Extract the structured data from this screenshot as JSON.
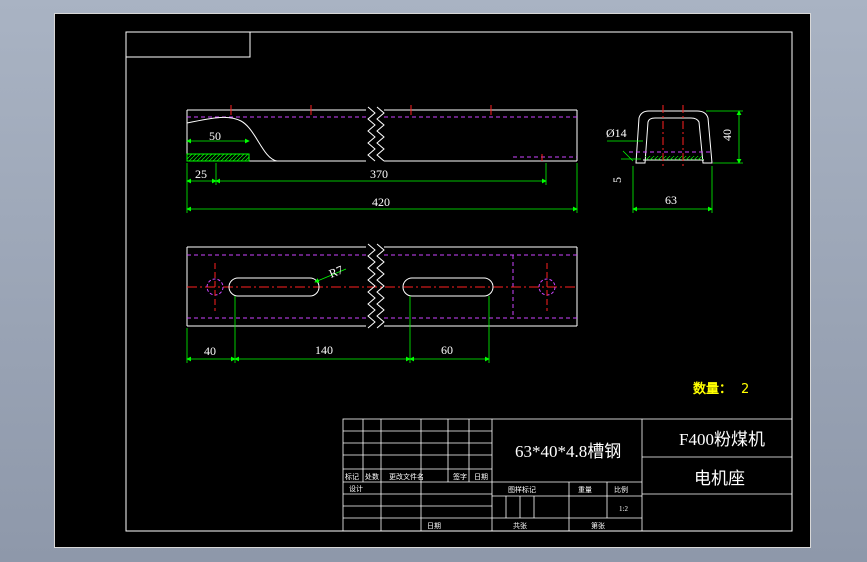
{
  "drawing": {
    "dims_top": {
      "d50": "50",
      "d25": "25",
      "d370": "370",
      "d420": "420"
    },
    "dims_side": {
      "phi14": "Ø14",
      "d40": "40",
      "d5": "5",
      "d63": "63"
    },
    "dims_bottom": {
      "r7": "R7",
      "d40": "40",
      "d140": "140",
      "d60": "60"
    },
    "quantity_label": "数量：",
    "quantity_value": "2"
  },
  "title_block": {
    "material": "63*40*4.8槽钢",
    "project": "F400粉煤机",
    "part_name": "电机座",
    "header_labels": [
      "标记",
      "处数",
      "更改文件名",
      "签字",
      "日期"
    ],
    "design_label": "设计",
    "date_label": "日期",
    "stage_labels": [
      "图样标记",
      "重量",
      "比例"
    ],
    "scale": "1:2",
    "sheet_labels": [
      "共张",
      "第张"
    ]
  },
  "colors": {
    "sheet_bg": "#000000",
    "outline": "#ffffff",
    "dimension": "#00ff00",
    "center_line": "#ff2020",
    "hidden_line": "#cc44ff",
    "annotation": "#ffff00"
  }
}
